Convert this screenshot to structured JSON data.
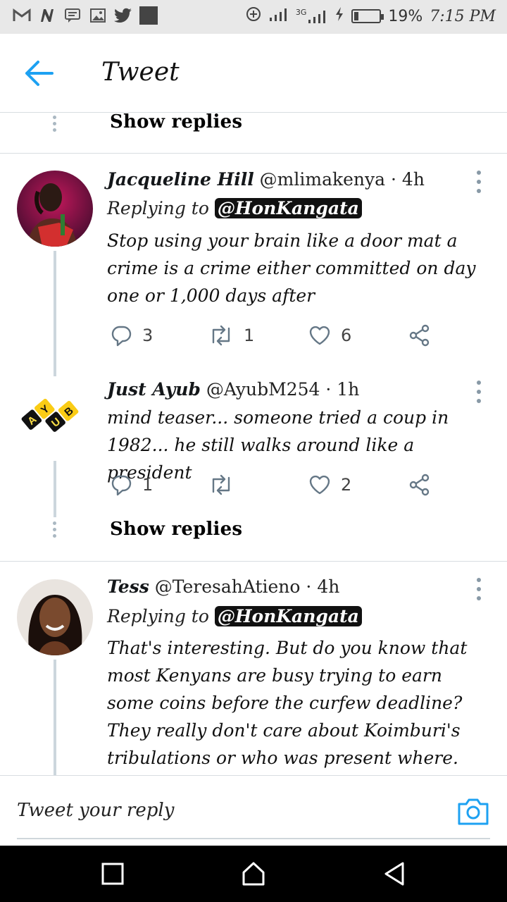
{
  "status_bar": {
    "icons_left": [
      "gmail-icon",
      "n-app-icon",
      "message-icon",
      "gallery-icon",
      "twitter-icon",
      "app-square-icon"
    ],
    "network": "3G",
    "battery": "19%",
    "battery_level": 0.19,
    "time": "7:15 PM"
  },
  "header": {
    "title": "Tweet"
  },
  "show_replies_label": "Show replies",
  "tweets": [
    {
      "name": "Jacqueline  Hill",
      "handle": "@mlimakenya",
      "time": "· 4h",
      "replying_prefix": "Replying to",
      "replying_to": "@HonKangata",
      "text": "Stop using your brain like a door mat a crime is a crime either committed on day one or 1,000 days after",
      "replies": "3",
      "retweets": "1",
      "likes": "6"
    },
    {
      "name": "Just Ayub",
      "handle": "@AyubM254",
      "time": "· 1h",
      "avatar_letters": [
        "A",
        "Y",
        "U",
        "B"
      ],
      "text": "mind teaser... someone tried a coup in 1982... he still walks around like a president",
      "replies": "1",
      "retweets": "",
      "likes": "2"
    },
    {
      "name": "Tess",
      "handle": "@TeresahAtieno",
      "time": "· 4h",
      "replying_prefix": "Replying to",
      "replying_to": "@HonKangata",
      "text": "That's interesting. But do you know that most Kenyans are busy trying to earn some coins before the curfew deadline? They really don't care about Koimburi's tribulations or who was present where."
    }
  ],
  "reply_bar": {
    "placeholder": "Tweet your reply"
  },
  "colors": {
    "accent": "#1da1f2",
    "icon_gray": "#657786",
    "divider": "#d8dde1"
  }
}
